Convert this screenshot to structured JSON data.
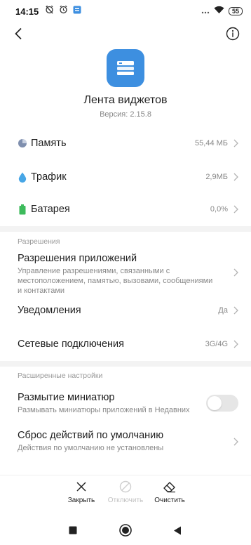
{
  "status_bar": {
    "time": "14:15",
    "battery": "55",
    "left_icons": [
      "alarm-off-icon",
      "alarm-icon",
      "notification-app-icon"
    ],
    "right_icons": [
      "more-icon",
      "wifi-icon"
    ]
  },
  "header": {
    "app_name": "Лента виджетов",
    "version": "Версия: 2.15.8"
  },
  "usage": {
    "memory": {
      "label": "Память",
      "value": "55,44 МБ"
    },
    "traffic": {
      "label": "Трафик",
      "value": "2,9МБ"
    },
    "battery": {
      "label": "Батарея",
      "value": "0,0%"
    }
  },
  "permissions_section": {
    "title": "Разрешения",
    "app_permissions": {
      "title": "Разрешения приложений",
      "subtitle": "Управление разрешениями, связанными с местоположением, памятью, вызовами, сообщениями и контактами"
    },
    "notifications": {
      "label": "Уведомления",
      "value": "Да"
    },
    "network": {
      "label": "Сетевые подключения",
      "value": "3G/4G"
    }
  },
  "advanced_section": {
    "title": "Расширенные настройки",
    "blur": {
      "title": "Размытие миниатюр",
      "subtitle": "Размывать миниатюры приложений в Недавних",
      "enabled": false
    },
    "defaults": {
      "title": "Сброс действий по умолчанию",
      "subtitle": "Действия по умолчанию не установлены"
    }
  },
  "actions": {
    "force_stop": "Закрыть",
    "disable": "Отключить",
    "clear": "Очистить"
  },
  "colors": {
    "app_icon": "#3d8fe0",
    "memory_icon": "#7f8fae",
    "traffic_icon": "#47a6e6",
    "battery_icon": "#3dbb5c"
  }
}
